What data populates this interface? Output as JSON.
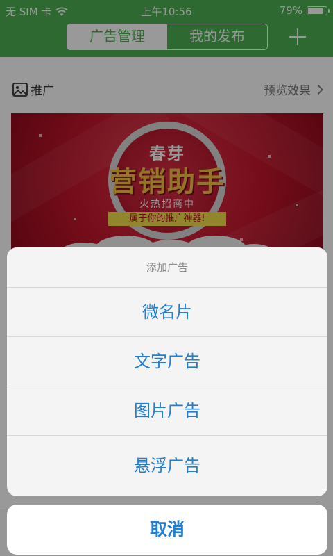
{
  "status_bar": {
    "carrier": "无 SIM 卡",
    "time": "上午10:56",
    "battery": "79%"
  },
  "header": {
    "tabs": [
      {
        "label": "广告管理",
        "active": true
      },
      {
        "label": "我的发布",
        "active": false
      }
    ]
  },
  "section": {
    "label": "推广",
    "preview": "预览效果"
  },
  "banner": {
    "line1": "春芽",
    "line2": "营销助手",
    "line3": "火热招商中",
    "line4": "属于你的推广神器!"
  },
  "action_sheet": {
    "title": "添加广告",
    "options": [
      "微名片",
      "文字广告",
      "图片广告",
      "悬浮广告"
    ],
    "cancel": "取消"
  },
  "colors": {
    "brand_green": "#4cb052",
    "action_blue": "#1f7fd5"
  }
}
